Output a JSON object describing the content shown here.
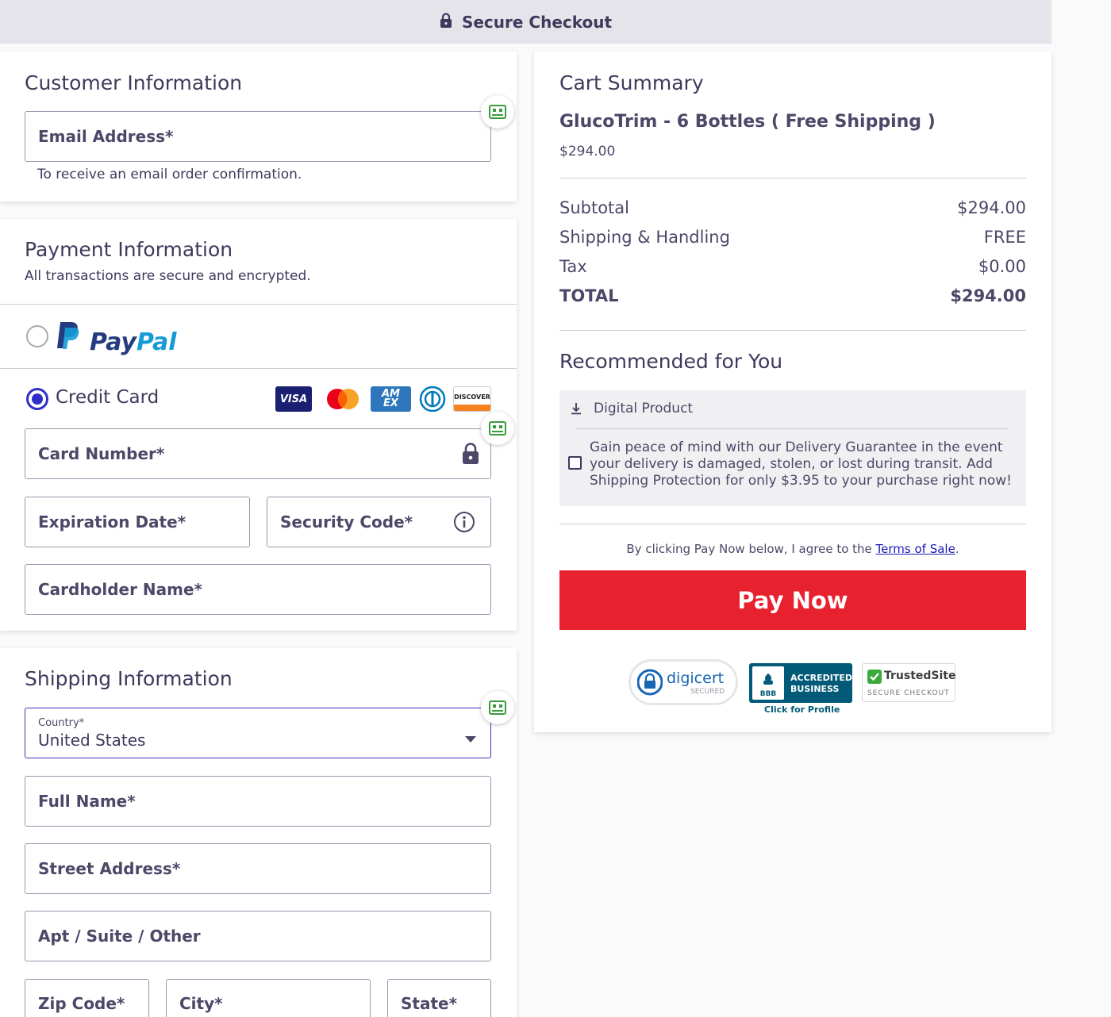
{
  "header": {
    "title": "Secure Checkout",
    "icon": "lock-icon"
  },
  "customer": {
    "heading": "Customer Information",
    "email_label": "Email Address*",
    "email_hint": "To receive an email order confirmation."
  },
  "payment": {
    "heading": "Payment Information",
    "subtitle": "All transactions are secure and encrypted.",
    "paypal_label_pay": "Pay",
    "paypal_label_pal": "Pal",
    "paypal_selected": false,
    "credit_label": "Credit Card",
    "credit_selected": true,
    "card_brands": [
      "visa-logo",
      "mastercard-logo",
      "amex-logo",
      "diners-logo",
      "discover-logo"
    ],
    "visa_text": "VISA",
    "amex_text_top": "AM",
    "amex_text_bottom": "EX",
    "discover_text": "DISCOVER",
    "card_number_label": "Card Number*",
    "expiration_label": "Expiration Date*",
    "security_label": "Security Code*",
    "cardholder_label": "Cardholder Name*"
  },
  "shipping": {
    "heading": "Shipping Information",
    "country_label": "Country*",
    "country_value": "United States",
    "full_name_label": "Full Name*",
    "street_label": "Street Address*",
    "apt_label": "Apt / Suite / Other",
    "zip_label": "Zip Code*",
    "city_label": "City*",
    "state_label": "State*"
  },
  "cart": {
    "heading": "Cart Summary",
    "product_name": "GlucoTrim - 6 Bottles ( Free Shipping )",
    "product_price": "$294.00",
    "subtotal_label": "Subtotal",
    "subtotal_value": "$294.00",
    "shipping_label": "Shipping & Handling",
    "shipping_value": "FREE",
    "tax_label": "Tax",
    "tax_value": "$0.00",
    "total_label": "TOTAL",
    "total_value": "$294.00"
  },
  "recommended": {
    "heading": "Recommended for You",
    "product_type": "Digital Product",
    "offer_text": "Gain peace of mind with our Delivery Guarantee in the event your delivery is damaged, stolen, or lost during transit. Add Shipping Protection for only $3.95 to your purchase right now!",
    "offer_checked": false
  },
  "checkout": {
    "terms_prefix": "By clicking Pay Now below, I agree to the ",
    "terms_link": "Terms of Sale",
    "terms_suffix": ".",
    "pay_button": "Pay Now"
  },
  "badges": {
    "digicert_text": "digicert",
    "digicert_sub": "SECURED",
    "bbb_line1": "ACCREDITED",
    "bbb_line2": "BUSINESS",
    "bbb_mark": "BBB",
    "bbb_caption": "Click for Profile",
    "trusted_text": "TrustedSite",
    "trusted_sub": "SECURE CHECKOUT"
  },
  "colors": {
    "primary_text": "#3d3a5c",
    "accent_blue": "#2d2ec9",
    "pay_button": "#e8212f",
    "topbar_bg": "#e4e4ea"
  }
}
